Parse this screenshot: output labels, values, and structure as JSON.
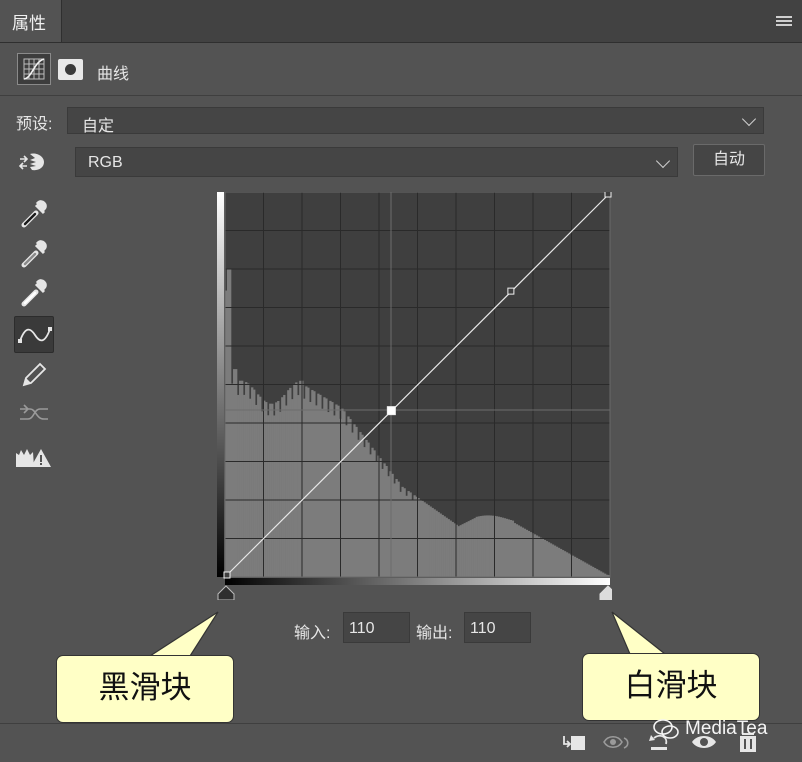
{
  "panel": {
    "tab_label": "属性",
    "title": "曲线"
  },
  "preset": {
    "label": "预设:",
    "value": "自定"
  },
  "channel": {
    "value": "RGB",
    "auto_button": "自动"
  },
  "tools": [
    "sample-black-point-eyedropper-icon",
    "sample-gray-point-eyedropper-icon",
    "sample-white-point-eyedropper-icon",
    "edit-points-curve-icon",
    "draw-pencil-icon",
    "smooth-curve-icon",
    "clipping-warning-icon"
  ],
  "curve": {
    "points": [
      {
        "input": 0,
        "output": 0
      },
      {
        "input": 110,
        "output": 110
      },
      {
        "input": 190,
        "output": 190
      },
      {
        "input": 255,
        "output": 255
      }
    ],
    "selected_point": {
      "input": 110,
      "output": 110
    }
  },
  "readout": {
    "input_label": "输入:",
    "input_value": "110",
    "output_label": "输出:",
    "output_value": "110"
  },
  "callouts": {
    "black_slider": "黑滑块",
    "white_slider": "白滑块"
  },
  "watermark": "MediaTea",
  "colors": {
    "panel_bg": "#535353",
    "graph_bg": "#3f3f3f",
    "histogram": "#7c7c7c",
    "callout_fill": "#ffffc6"
  }
}
